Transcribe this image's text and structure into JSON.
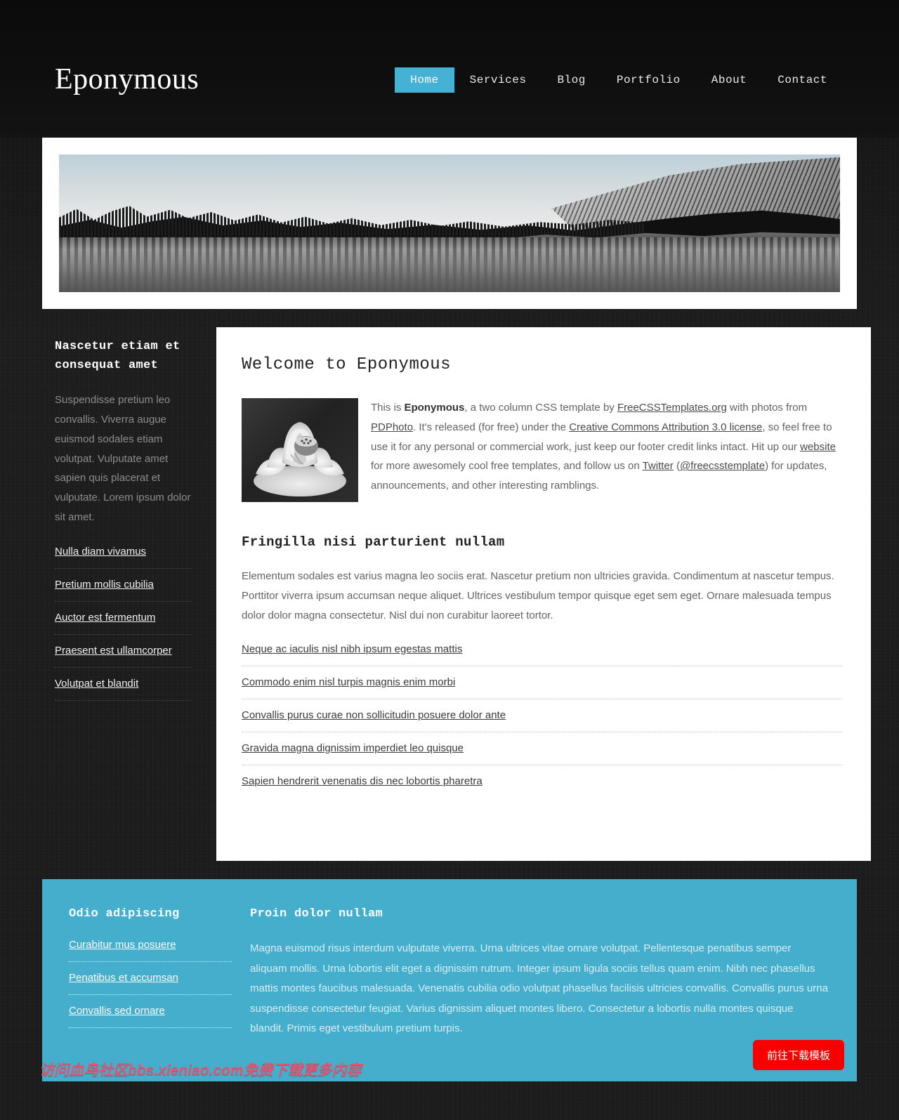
{
  "header": {
    "logo": "Eponymous",
    "nav": [
      {
        "label": "Home",
        "active": true
      },
      {
        "label": "Services",
        "active": false
      },
      {
        "label": "Blog",
        "active": false
      },
      {
        "label": "Portfolio",
        "active": false
      },
      {
        "label": "About",
        "active": false
      },
      {
        "label": "Contact",
        "active": false
      }
    ]
  },
  "banner": {
    "alt": "black and white lake with pine trees and rocky cliff"
  },
  "sidebar": {
    "heading": "Nascetur etiam et consequat amet",
    "intro": "Suspendisse pretium leo convallis. Viverra augue euismod sodales etiam volutpat. Vulputate amet sapien quis placerat et vulputate. Lorem ipsum dolor sit amet.",
    "links": [
      "Nulla diam vivamus",
      "Pretium mollis cubilia",
      "Auctor est fermentum",
      "Praesent est ullamcorper",
      "Volutpat et blandit"
    ]
  },
  "main": {
    "title": "Welcome to Eponymous",
    "thumb_alt": "black and white lotus flower",
    "intro": {
      "t1": "This is ",
      "brand": "Eponymous",
      "t2": ", a two column CSS template by ",
      "link1": "FreeCSSTemplates.org",
      "t3": " with photos from ",
      "link2": "PDPhoto",
      "t4": ". It's released (for free) under the ",
      "link3": "Creative Commons Attribution 3.0 license",
      "t5": ", so feel free to use it for any personal or commercial work, just keep our footer credit links intact. Hit up our ",
      "link4": "website",
      "t6": " for more awesomely cool free templates, and follow us on ",
      "link5": "Twitter",
      "t7": " (",
      "link6": "@freecsstemplate",
      "t8": ") for updates, announcements, and other interesting ramblings."
    },
    "section_title": "Fringilla nisi parturient nullam",
    "section_body": "Elementum sodales est varius magna leo sociis erat. Nascetur pretium non ultricies gravida. Condimentum at nascetur tempus. Porttitor viverra ipsum accumsan neque aliquet. Ultrices vestibulum tempor quisque eget sem eget. Ornare malesuada tempus dolor dolor magna consectetur. Nisl dui non curabitur laoreet tortor.",
    "links": [
      "Neque ac iaculis nisl nibh ipsum egestas mattis",
      "Commodo enim nisl turpis magnis enim morbi",
      "Convallis purus curae non sollicitudin posuere dolor ante",
      "Gravida magna dignissim imperdiet leo quisque",
      "Sapien hendrerit venenatis dis nec lobortis pharetra"
    ]
  },
  "footer": {
    "left_heading": "Odio adipiscing",
    "left_links": [
      "Curabitur mus posuere",
      "Penatibus et accumsan",
      "Convallis sed ornare"
    ],
    "right_heading": "Proin dolor nullam",
    "right_body": "Magna euismod risus interdum vulputate viverra. Urna ultrices vitae ornare volutpat. Pellentesque penatibus semper aliquam mollis. Urna lobortis elit eget a dignissim rutrum. Integer ipsum ligula sociis tellus quam enim. Nibh nec phasellus mattis montes faucibus malesuada. Venenatis cubilia odio volutpat phasellus facilisis ultricies convallis. Convallis purus urna suspendisse consectetur feugiat. Varius dignissim aliquet montes libero. Consectetur a lobortis nulla montes quisque blandit. Primis eget vestibulum pretium turpis.",
    "download_button": "前往下载模板"
  },
  "overlay": {
    "watermark": "访问血鸟社区bbs.xieniao.com免费下载更多内容"
  },
  "colors": {
    "accent": "#45aecd",
    "nav_active": "#45b1d4",
    "button_red": "#f80000",
    "watermark_pink": "#e2566f"
  }
}
